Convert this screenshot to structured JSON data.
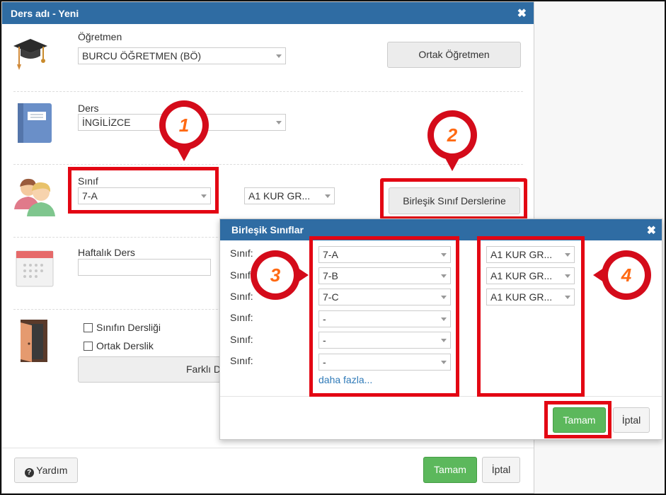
{
  "dialog": {
    "title": "Ders adı - Yeni",
    "teacher_label": "Öğretmen",
    "teacher_value": "BURCU ÖĞRETMEN (BÖ)",
    "shared_teacher_button": "Ortak Öğretmen",
    "course_label": "Ders",
    "course_value": "İNGİLİZCE",
    "class_label": "Sınıf",
    "class_value": "7-A",
    "group_value": "A1 KUR GR...",
    "combined_button": "Birleşik Sınıf Derslerine",
    "weekly_label": "Haftalık Ders",
    "weekly_value": "",
    "classroom_option": "Sınıfın Dersliği",
    "shared_classroom_option": "Ortak Derslik",
    "different_button": "Farklı D",
    "help_button": "Yardım",
    "ok_button": "Tamam",
    "cancel_button": "İptal"
  },
  "sub_dialog": {
    "title": "Birleşik Sınıflar",
    "rows": [
      {
        "label": "Sınıf:",
        "class": "7-A",
        "group": "A1 KUR GR..."
      },
      {
        "label": "Sınıf:",
        "class": "7-B",
        "group": "A1 KUR GR..."
      },
      {
        "label": "Sınıf:",
        "class": "7-C",
        "group": "A1 KUR GR..."
      },
      {
        "label": "Sınıf:",
        "class": "-",
        "group": ""
      },
      {
        "label": "Sınıf:",
        "class": "-",
        "group": ""
      },
      {
        "label": "Sınıf:",
        "class": "-",
        "group": ""
      }
    ],
    "more_link": "daha fazla...",
    "ok_button": "Tamam",
    "cancel_button": "İptal"
  },
  "markers": [
    "1",
    "2",
    "3",
    "4"
  ],
  "icons": [
    "graduation-cap-icon",
    "book-icon",
    "students-icon",
    "calendar-icon",
    "door-icon",
    "question-icon",
    "close-icon"
  ],
  "colors": {
    "header": "#2f6ca3",
    "highlight": "#e30613",
    "green": "#5cb85c"
  }
}
